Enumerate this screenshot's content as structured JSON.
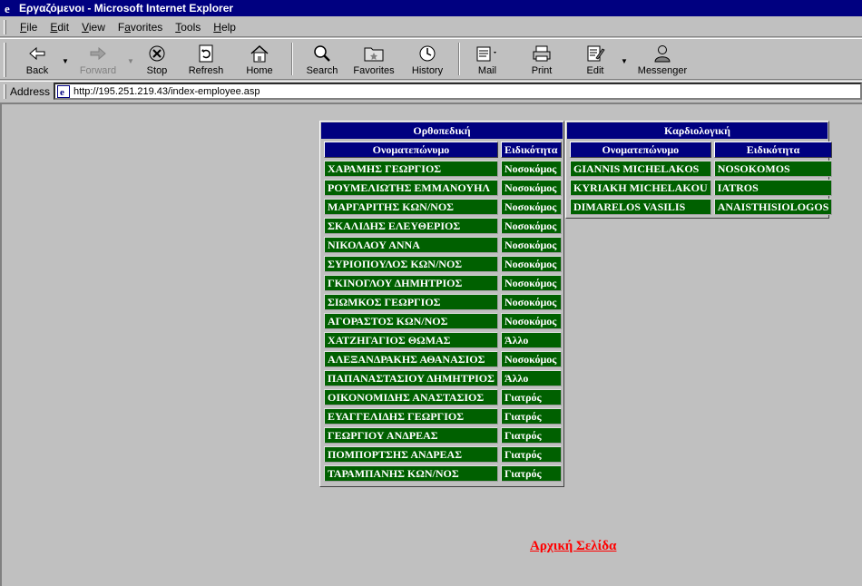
{
  "window": {
    "title": "Εργαζόμενοι - Microsoft Internet Explorer"
  },
  "menu": {
    "items": [
      {
        "key": "F",
        "rest": "ile"
      },
      {
        "key": "E",
        "rest": "dit"
      },
      {
        "key": "V",
        "rest": "iew"
      },
      {
        "key": "a",
        "pre": "F",
        "rest": "vorites"
      },
      {
        "key": "T",
        "rest": "ools"
      },
      {
        "key": "H",
        "rest": "elp"
      }
    ]
  },
  "toolbar": {
    "back": "Back",
    "forward": "Forward",
    "stop": "Stop",
    "refresh": "Refresh",
    "home": "Home",
    "search": "Search",
    "favorites": "Favorites",
    "history": "History",
    "mail": "Mail",
    "print": "Print",
    "edit": "Edit",
    "messenger": "Messenger"
  },
  "address": {
    "label": "Address",
    "url": "http://195.251.219.43/index-employee.asp"
  },
  "orthopedic": {
    "title": "Ορθοπεδική",
    "col_name": "Ονοματεπώνυμο",
    "col_specialty": "Ειδικότητα",
    "rows": [
      {
        "name": "ΧΑΡΑΜΗΣ ΓΕΩΡΓΙΟΣ",
        "specialty": "Νοσοκόμος"
      },
      {
        "name": "ΡΟΥΜΕΛΙΩΤΗΣ ΕΜΜΑΝΟΥΗΛ",
        "specialty": "Νοσοκόμος"
      },
      {
        "name": "ΜΑΡΓΑΡΙΤΗΣ ΚΩΝ/ΝΟΣ",
        "specialty": "Νοσοκόμος"
      },
      {
        "name": "ΣΚΑΛΙΔΗΣ ΕΛΕΥΘΕΡΙΟΣ",
        "specialty": "Νοσοκόμος"
      },
      {
        "name": "ΝΙΚΟΛΑΟΥ ΑΝΝΑ",
        "specialty": "Νοσοκόμος"
      },
      {
        "name": "ΣΥΡΙΟΠΟΥΛΟΣ ΚΩΝ/ΝΟΣ",
        "specialty": "Νοσοκόμος"
      },
      {
        "name": "ΓΚΙΝΟΓΛΟΥ ΔΗΜΗΤΡΙΟΣ",
        "specialty": "Νοσοκόμος"
      },
      {
        "name": "ΣΙΩΜΚΟΣ ΓΕΩΡΓΙΟΣ",
        "specialty": "Νοσοκόμος"
      },
      {
        "name": "ΑΓΟΡΑΣΤΟΣ ΚΩΝ/ΝΟΣ",
        "specialty": "Νοσοκόμος"
      },
      {
        "name": "ΧΑΤΖΗΓΑΓΙΟΣ ΘΩΜΑΣ",
        "specialty": "Άλλο"
      },
      {
        "name": "ΑΛΕΞΑΝΔΡΑΚΗΣ ΑΘΑΝΑΣΙΟΣ",
        "specialty": "Νοσοκόμος"
      },
      {
        "name": "ΠΑΠΑΝΑΣΤΑΣΙΟΥ ΔΗΜΗΤΡΙΟΣ",
        "specialty": "Άλλο"
      },
      {
        "name": "ΟΙΚΟΝΟΜΙΔΗΣ ΑΝΑΣΤΑΣΙΟΣ",
        "specialty": "Γιατρός"
      },
      {
        "name": "ΕΥΑΓΓΕΛΙΔΗΣ ΓΕΩΡΓΙΟΣ",
        "specialty": "Γιατρός"
      },
      {
        "name": "ΓΕΩΡΓΙΟΥ ΑΝΔΡΕΑΣ",
        "specialty": "Γιατρός"
      },
      {
        "name": "ΠΟΜΠΟΡΤΣΗΣ ΑΝΔΡΕΑΣ",
        "specialty": "Γιατρός"
      },
      {
        "name": "ΤΑΡΑΜΠΑΝΗΣ ΚΩΝ/ΝΟΣ",
        "specialty": "Γιατρός"
      }
    ]
  },
  "cardiology": {
    "title": "Καρδιολογική",
    "col_name": "Ονοματεπώνυμο",
    "col_specialty": "Ειδικότητα",
    "rows": [
      {
        "name": "GIANNIS MICHELAKOS",
        "specialty": "NOSOKOMOS"
      },
      {
        "name": "KYRIAKH MICHELAKOU",
        "specialty": "IATROS"
      },
      {
        "name": "DIMARELOS VASILIS",
        "specialty": "ANAISTHISIOLOGOS"
      }
    ]
  },
  "home_link": "Αρχική Σελίδα"
}
